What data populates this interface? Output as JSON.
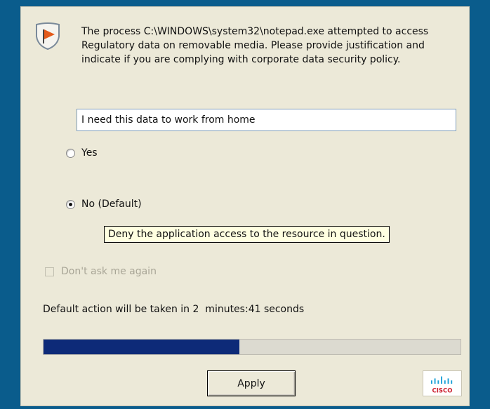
{
  "dialog": {
    "message": "The process C:\\WINDOWS\\system32\\notepad.exe attempted to access Regulatory data on removable media. Please provide justification and indicate if you are complying with corporate data security policy.",
    "justification_value": "I need this data to work from home",
    "options": {
      "yes_label": "Yes",
      "no_label": "No (Default)",
      "selected": "no"
    },
    "tooltip": "Deny the application access to the resource in question.",
    "dont_ask_label": "Don't ask me again",
    "countdown": "Default action will be taken in 2  minutes:41 seconds",
    "progress_fraction": 0.47,
    "apply_label": "Apply"
  },
  "icons": [
    "shield-flag-icon",
    "cisco-logo"
  ],
  "colors": {
    "background": "#0a5c8c",
    "dialog_bg": "#ece9d8",
    "progress_fill": "#0d2a78",
    "tooltip_bg": "#ffffe1",
    "disabled_text": "#a8a596",
    "cisco_blue": "#1ba0d7",
    "cisco_red": "#cc1f2f"
  },
  "cisco_text": "CISCO"
}
